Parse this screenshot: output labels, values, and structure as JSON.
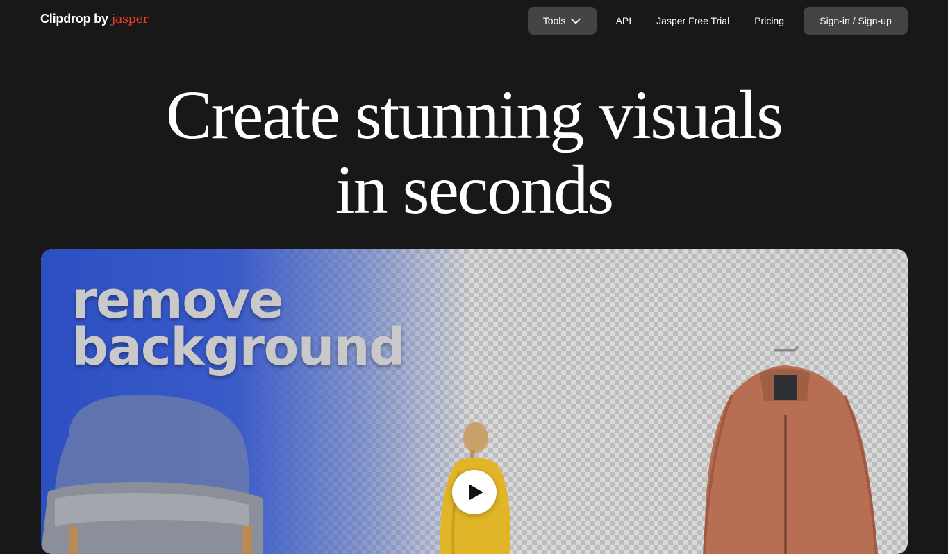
{
  "header": {
    "logo_text": "Clipdrop by",
    "logo_brand": "jasper",
    "nav": {
      "tools_label": "Tools",
      "api_label": "API",
      "trial_label": "Jasper Free Trial",
      "pricing_label": "Pricing",
      "signin_label": "Sign-in / Sign-up"
    }
  },
  "hero": {
    "title_line1": "Create stunning visuals",
    "title_line2": "in seconds"
  },
  "media": {
    "overlay_line1": "remove",
    "overlay_line2": "background",
    "play_icon": "play-icon"
  },
  "colors": {
    "background": "#181818",
    "brand_accent": "#e8402b",
    "button_bg": "#444444"
  }
}
